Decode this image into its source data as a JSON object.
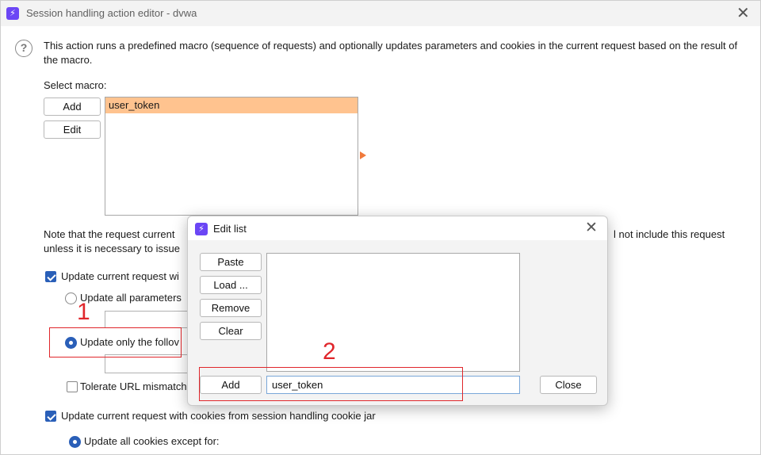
{
  "window": {
    "title": "Session handling action editor - dvwa",
    "icon": "app-bolt-icon"
  },
  "description": "This action runs a predefined macro (sequence of requests) and optionally updates parameters and cookies in the current request based on the result of the macro.",
  "macro": {
    "label": "Select macro:",
    "add_label": "Add",
    "edit_label": "Edit",
    "items": [
      "user_token"
    ]
  },
  "note": {
    "line1_left": "Note that the request current",
    "line1_right": "l not include this request",
    "line2_left": "unless it is necessary to issue"
  },
  "options": {
    "update_params_label": "Update current request wi",
    "update_params_checked": true,
    "all_params_label": "Update all parameters",
    "only_following_label": "Update only the follov",
    "only_following_selected": true,
    "tolerate_url_label": "Tolerate URL mismatch",
    "tolerate_url_checked": false,
    "update_cookies_label": "Update current request with cookies from session handling cookie jar",
    "update_cookies_checked": true,
    "all_cookies_label": "Update all cookies except for:",
    "all_cookies_selected": true
  },
  "annotations": {
    "marker1": "1",
    "marker2": "2",
    "color": "#e0262b"
  },
  "edit_list": {
    "title": "Edit list",
    "paste_label": "Paste",
    "load_label": "Load ...",
    "remove_label": "Remove",
    "clear_label": "Clear",
    "add_label": "Add",
    "input_value": "user_token",
    "close_label": "Close"
  },
  "colors": {
    "selection": "#ffc38f",
    "accent": "#2a5fb8",
    "app_icon": "#6b46f5"
  }
}
